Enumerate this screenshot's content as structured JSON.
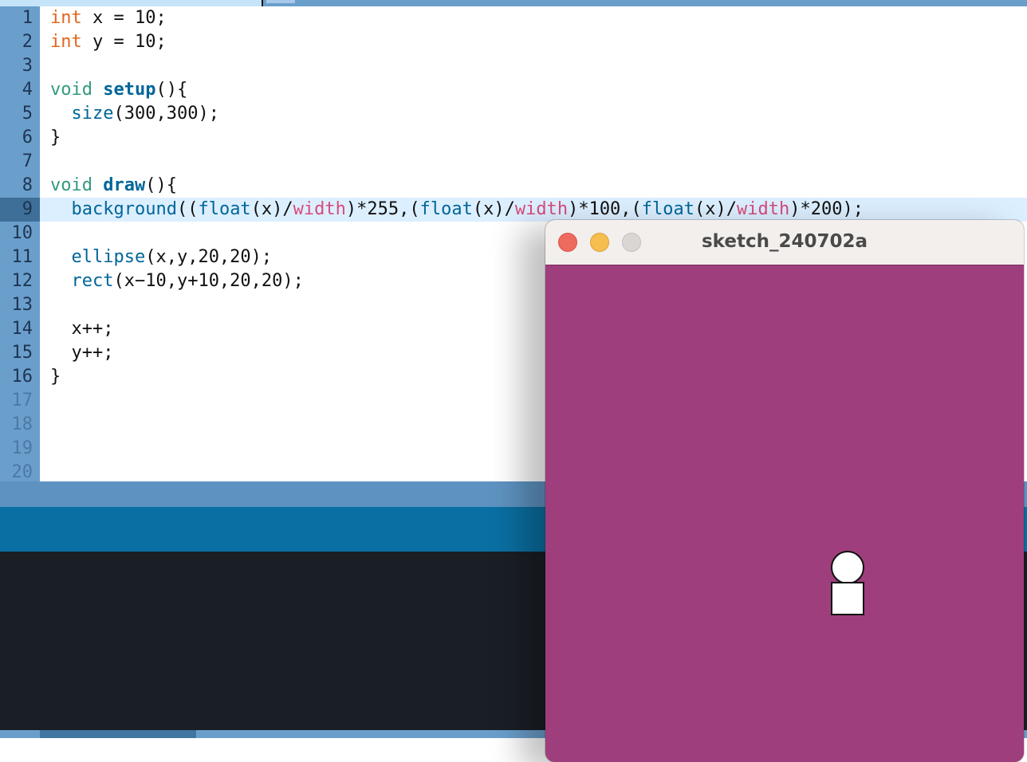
{
  "editor": {
    "lines": [
      {
        "num": "1"
      },
      {
        "num": "2"
      },
      {
        "num": "3"
      },
      {
        "num": "4"
      },
      {
        "num": "5"
      },
      {
        "num": "6"
      },
      {
        "num": "7"
      },
      {
        "num": "8"
      },
      {
        "num": "9"
      },
      {
        "num": "10"
      },
      {
        "num": "11"
      },
      {
        "num": "12"
      },
      {
        "num": "13"
      },
      {
        "num": "14"
      },
      {
        "num": "15"
      },
      {
        "num": "16"
      },
      {
        "num": "17"
      },
      {
        "num": "18"
      },
      {
        "num": "19"
      },
      {
        "num": "20"
      }
    ],
    "current_line": "9",
    "tokens": {
      "int": "int",
      "void": "void",
      "setup": "setup",
      "draw": "draw",
      "size": "size",
      "background": "background",
      "float": "float",
      "width": "width",
      "ellipse": "ellipse",
      "rect": "rect",
      "l1_rest": " x = 10;",
      "l2_rest": " y = 10;",
      "paren_brace": "(){",
      "size_args": "(300,300);",
      "close_brace": "}",
      "bg_open": "((",
      "x_div": "(x)/",
      "mul255": ")*255,(",
      "mul100": ")*100,(",
      "mul200": ")*200);",
      "ellipse_args": "(x,y,20,20);",
      "rect_args": "(x−10,y+10,20,20);",
      "xpp": "x++;",
      "ypp": "y++;"
    }
  },
  "sketch_window": {
    "title": "sketch_240702a",
    "buttons": {
      "close": "close",
      "minimize": "minimize",
      "zoom": "zoom"
    },
    "canvas_bg": "#9e3e7c"
  },
  "colors": {
    "gutter": "#6a9fcc",
    "current_line": "#dcefff",
    "toolbar": "#0a6fa2",
    "console": "#1a1f26"
  }
}
